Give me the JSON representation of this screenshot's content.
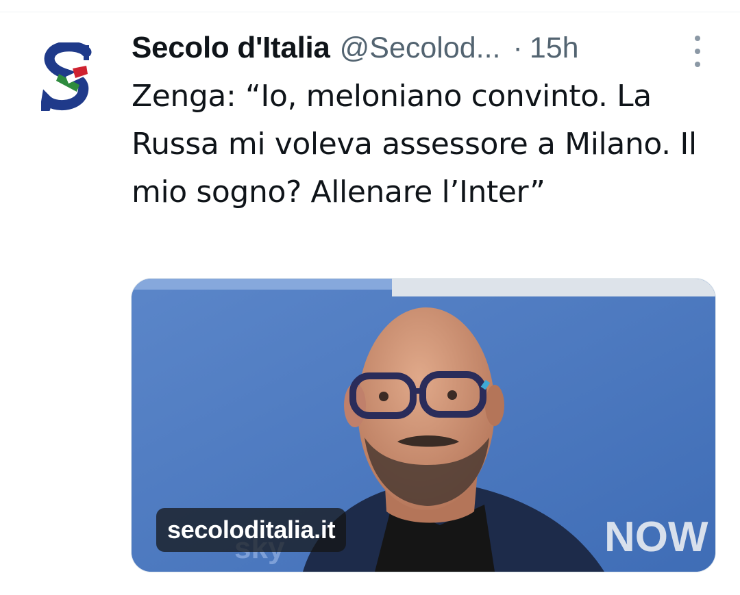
{
  "tweet": {
    "author": {
      "display_name": "Secolo d'Italia",
      "handle": "@Secolod...",
      "avatar_icon": "secolo-ditalia-logo"
    },
    "separator": "·",
    "time": "15h",
    "text": "Zenga: “Io, meloniano convinto. La Russa mi voleva assessore a Milano. Il mio sogno? Allenare l’Inter”",
    "link_card": {
      "domain": "secoloditalia.it"
    },
    "more_icon": "more-vertical-icon"
  },
  "colors": {
    "text_primary": "#0f1419",
    "text_secondary": "#536471",
    "logo_blue": "#1f3a8a",
    "media_background": "#4a76bd"
  }
}
